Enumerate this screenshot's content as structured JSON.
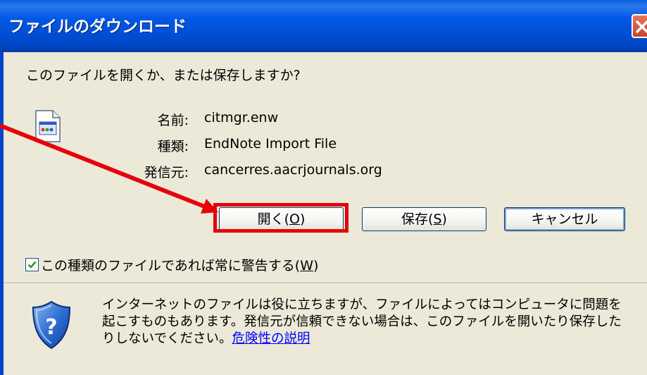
{
  "window": {
    "title": "ファイルのダウンロード",
    "close_icon": "close-icon"
  },
  "dialog": {
    "question": "このファイルを開くか、または保存しますか?",
    "file_icon": "endnote-file-icon",
    "info": {
      "name_label": "名前:",
      "name_value": "citmgr.enw",
      "type_label": "種類:",
      "type_value": "EndNote Import File",
      "from_label": "発信元:",
      "from_value": "cancerres.aacrjournals.org"
    },
    "buttons": {
      "open_label": "開く(",
      "open_key": "O",
      "open_tail": ")",
      "save_label": "保存(",
      "save_key": "S",
      "save_tail": ")",
      "cancel_label": "キャンセル"
    },
    "always_ask": {
      "checked": true,
      "label": "この種類のファイルであれば常に警告する(",
      "key": "W",
      "tail": ")"
    },
    "warning": {
      "icon": "shield-question-icon",
      "text": "インターネットのファイルは役に立ちますが、ファイルによってはコンピュータに問題を起こすものもあります。発信元が信頼できない場合は、このファイルを開いたり保存したりしないでください。",
      "link": "危険性の説明"
    }
  },
  "annotation": {
    "arrow_color": "#e6000b",
    "highlight_color": "#e6000b"
  }
}
